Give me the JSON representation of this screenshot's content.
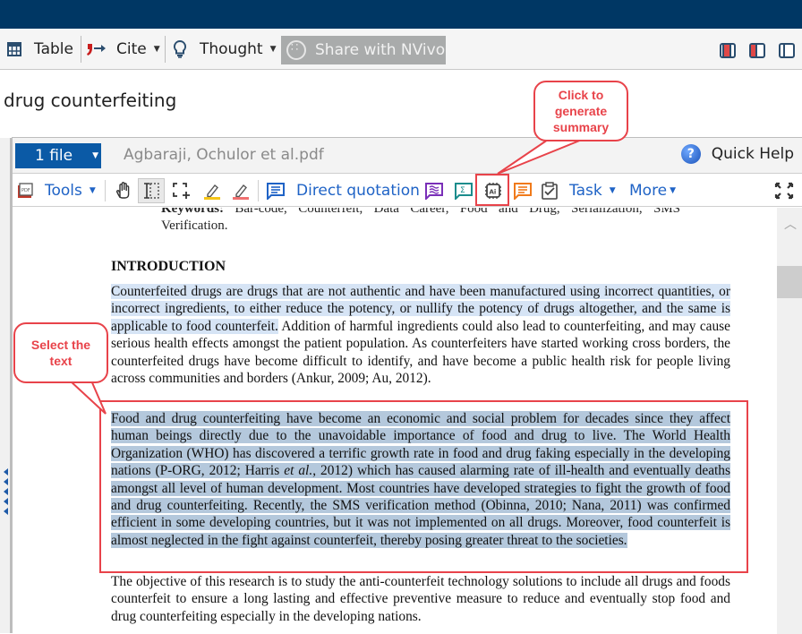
{
  "ribbon": {
    "table_label": "Table",
    "cite_label": "Cite",
    "thought_label": "Thought",
    "share_label": "Share with NVivo",
    "icons": [
      "table-icon",
      "cite-icon",
      "lightbulb-icon",
      "share-icon",
      "pane-layout-both-icon",
      "pane-layout-left-icon",
      "pane-layout-none-icon"
    ]
  },
  "page": {
    "heading": "drug counterfeiting"
  },
  "viewer": {
    "file_button_label": "1 file",
    "filename": "Agbaraji, Ochulor et al.pdf",
    "quick_help_label": "Quick Help",
    "toolbar": {
      "tools_label": "Tools",
      "direct_quotation_label": "Direct quotation",
      "task_label": "Task",
      "more_label": "More"
    }
  },
  "document": {
    "keywords_label": "Keywords:",
    "keywords_text": "Bar-code, Counterfeit, Data Career, Food and Drug, Serialization, SMS Verification.",
    "section_heading": "INTRODUCTION",
    "para1_highlighted": "Counterfeited drugs are drugs that are not authentic and have been manufactured using incorrect quantities, or incorrect ingredients, to either reduce the potency, or nullify the potency of drugs altogether, and the same is applicable to food counterfeit.",
    "para1_rest": " Addition of harmful ingredients could also lead to counterfeiting, and may cause serious health effects amongst the patient population. As counterfeiters have started working cross borders, the counterfeited drugs have become difficult to identify, and have become a public health risk for people living across communities and borders (Ankur, 2009; Au, 2012).",
    "para2_before_italic": "Food and drug counterfeiting have become an economic and social problem for decades since they affect human beings directly due to the unavoidable importance of food and drug to live. The World Health Organization (WHO) has discovered a terrific growth rate in food and drug faking especially in the developing nations (P-ORG, 2012; Harris ",
    "para2_italic": "et al.",
    "para2_after_italic": ", 2012) which has caused alarming rate of ill-health and eventually deaths amongst all level of human development. Most countries have developed strategies to fight the growth of food and drug counterfeiting. Recently, the SMS verification method (Obinna, 2010; Nana, 2011) was confirmed efficient in some developing countries, but it was not implemented on all drugs. Moreover, food counterfeit is almost neglected in the fight against counterfeit, thereby posing greater threat to the societies.",
    "para3": "The objective of this research is to study the anti-counterfeit technology solutions to include all drugs and foods counterfeit to ensure a long lasting and effective preventive measure to reduce and eventually stop food and drug counterfeiting especially in the developing nations."
  },
  "annotations": {
    "summary_callout": "Click to generate summary",
    "select_callout": "Select the text"
  },
  "colors": {
    "titlebar": "#003764",
    "accent_blue": "#0b5aa6",
    "callout_red": "#e8434a",
    "selection": "#b4c8dc",
    "highlight": "#d6e4f5"
  }
}
